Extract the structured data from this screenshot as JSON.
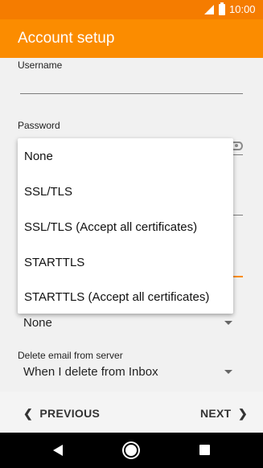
{
  "status_bar": {
    "time": "10:00"
  },
  "app_bar": {
    "title": "Account setup"
  },
  "form": {
    "username_label": "Username",
    "password_label": "Password",
    "security_value": "None",
    "delete_label": "Delete email from server",
    "delete_value": "When I delete from Inbox"
  },
  "menu": {
    "items": [
      "None",
      "SSL/TLS",
      "SSL/TLS (Accept all certificates)",
      "STARTTLS",
      "STARTTLS (Accept all certificates)"
    ]
  },
  "footer": {
    "previous_label": "PREVIOUS",
    "next_label": "NEXT"
  },
  "icons": {
    "signal": "signal-icon",
    "battery": "battery-icon",
    "eye": "eye-icon",
    "dropdown": "chevron-down-icon",
    "prev": "chevron-left-icon",
    "next": "chevron-right-icon",
    "back": "back-icon",
    "home": "home-icon",
    "recent": "recents-icon"
  },
  "colors": {
    "status_bar": "#f57c00",
    "app_bar": "#fb8c00",
    "accent": "#fb8c00"
  }
}
